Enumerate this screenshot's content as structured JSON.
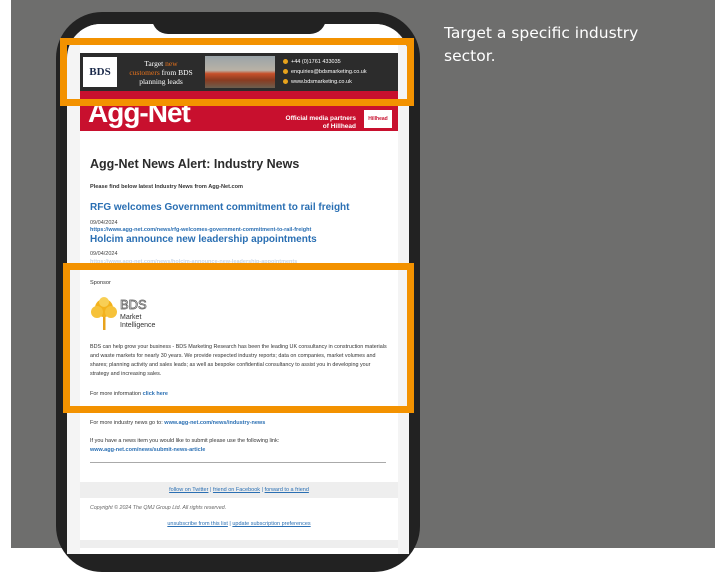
{
  "side_note": "Target a specific industry sector.",
  "banner": {
    "brand": "BDS",
    "line1": "Target",
    "line1_hl": "new",
    "line2_hl": "customers",
    "line2": "from BDS",
    "line3": "planning leads",
    "phone": "+44 (0)1761 433035",
    "email": "enquiries@bdsmarketing.co.uk",
    "web": "www.bdsmarketing.co.uk"
  },
  "header": {
    "logo": "Agg-Net",
    "partner_line1": "Official media partners",
    "partner_line2": "of Hillhead",
    "hillhead": "Hillhead"
  },
  "email": {
    "title": "Agg-Net News Alert: Industry News",
    "intro": "Please find below latest Industry News from Agg-Net.com",
    "news": [
      {
        "title": "RFG welcomes Government commitment to rail freight",
        "date": "09/04/2024",
        "url": "https://www.agg-net.com/news/rfg-welcomes-government-commitment-to-rail-freight"
      },
      {
        "title": "Holcim announce new leadership appointments",
        "date": "09/04/2024",
        "url": "https://www.agg-net.com/news/holcim-announce-new-leadership-appointments"
      }
    ],
    "sponsor_label": "Sponsor",
    "sponsor_logo": {
      "bds": "BDS",
      "market": "Market",
      "intelligence": "Intelligence"
    },
    "sponsor_body": "BDS can help grow your business - BDS Marketing Research has been the leading UK consultancy in construction materials and waste markets for nearly 30 years. We provide respected industry reports; data on companies, market volumes and shares; planning activity and sales leads; as well as bespoke confidential consultancy to assist you in developing your strategy and increasing sales.",
    "more_info_prefix": "For more information",
    "more_info_link": "click here",
    "more_news_prefix": "For more industry news go to:",
    "more_news_link": "www.agg-net.com/news/industry-news",
    "submit_text": "If you have a news item you would like to submit please use the following link:",
    "submit_link": "www.agg-net.com/news/submit-news-article",
    "social": [
      "follow on Twitter",
      "friend on Facebook",
      "forward to a friend"
    ],
    "copyright": "Copyright © 2024 The QMJ Group Ltd. All rights reserved.",
    "unsubscribe": [
      "unsubscribe from this list",
      "update subscription preferences"
    ]
  },
  "colors": {
    "accent_orange": "#f39200",
    "agg_red": "#c8102e",
    "link_blue": "#2a6fb3",
    "panel_gray": "#6e6e6d"
  }
}
